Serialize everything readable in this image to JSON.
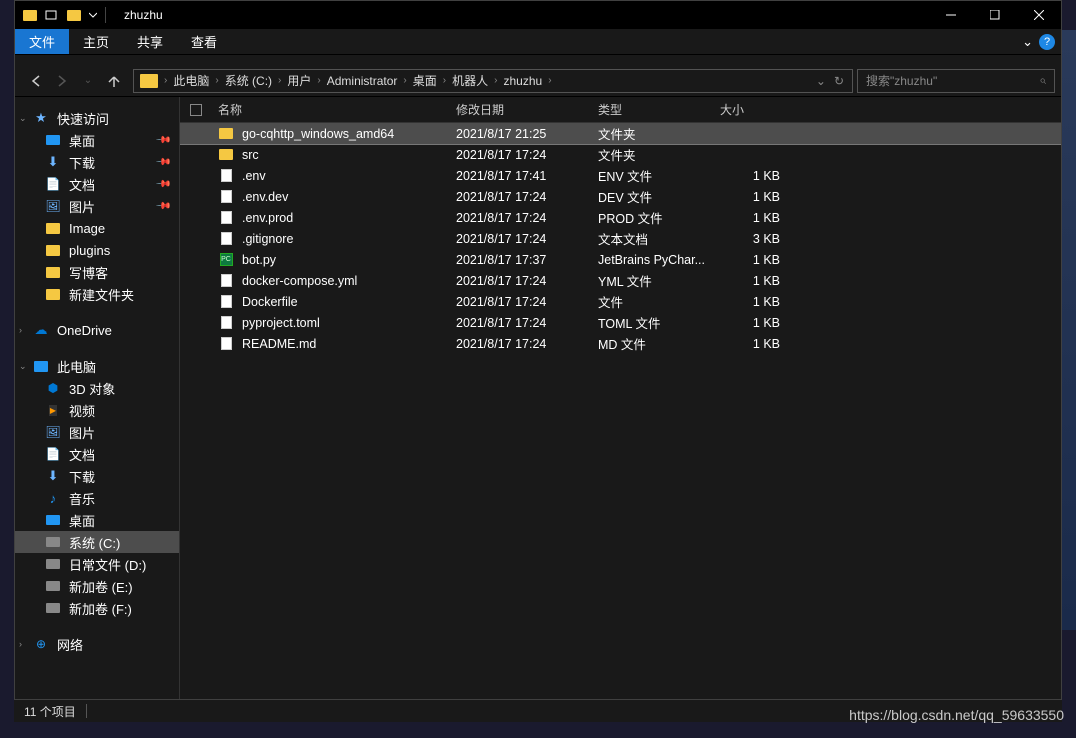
{
  "window": {
    "title": "zhuzhu",
    "controls": {
      "minimize": "–",
      "maximize": "□",
      "close": "×"
    }
  },
  "ribbon": {
    "file": "文件",
    "home": "主页",
    "share": "共享",
    "view": "查看",
    "chevron": "⌄",
    "help": "?"
  },
  "nav": {
    "back": "←",
    "forward": "→",
    "dropdown": "⌄",
    "up": "↑",
    "refresh": "↻",
    "addr_dropdown": "⌄"
  },
  "breadcrumbs": [
    "此电脑",
    "系统 (C:)",
    "用户",
    "Administrator",
    "桌面",
    "机器人",
    "zhuzhu"
  ],
  "search": {
    "placeholder": "搜索\"zhuzhu\"",
    "icon": "⌕"
  },
  "sidebar": {
    "quick_access": {
      "label": "快速访问",
      "items": [
        {
          "label": "桌面",
          "icon": "desktop",
          "pinned": true
        },
        {
          "label": "下载",
          "icon": "download",
          "pinned": true
        },
        {
          "label": "文档",
          "icon": "doc",
          "pinned": true
        },
        {
          "label": "图片",
          "icon": "pic",
          "pinned": true
        },
        {
          "label": "Image",
          "icon": "folder",
          "pinned": false
        },
        {
          "label": "plugins",
          "icon": "folder",
          "pinned": false
        },
        {
          "label": "写博客",
          "icon": "folder",
          "pinned": false
        },
        {
          "label": "新建文件夹",
          "icon": "folder",
          "pinned": false
        }
      ]
    },
    "onedrive": {
      "label": "OneDrive"
    },
    "this_pc": {
      "label": "此电脑",
      "items": [
        {
          "label": "3D 对象",
          "icon": "3d"
        },
        {
          "label": "视频",
          "icon": "video"
        },
        {
          "label": "图片",
          "icon": "pic"
        },
        {
          "label": "文档",
          "icon": "doc"
        },
        {
          "label": "下载",
          "icon": "download"
        },
        {
          "label": "音乐",
          "icon": "music"
        },
        {
          "label": "桌面",
          "icon": "desktop"
        },
        {
          "label": "系统 (C:)",
          "icon": "drive",
          "selected": true
        },
        {
          "label": "日常文件 (D:)",
          "icon": "drive"
        },
        {
          "label": "新加卷 (E:)",
          "icon": "drive"
        },
        {
          "label": "新加卷 (F:)",
          "icon": "drive"
        }
      ]
    },
    "network": {
      "label": "网络"
    }
  },
  "columns": {
    "name": "名称",
    "date": "修改日期",
    "type": "类型",
    "size": "大小"
  },
  "files": [
    {
      "name": "go-cqhttp_windows_amd64",
      "date": "2021/8/17 21:25",
      "type": "文件夹",
      "size": "",
      "icon": "folder",
      "selected": true
    },
    {
      "name": "src",
      "date": "2021/8/17 17:24",
      "type": "文件夹",
      "size": "",
      "icon": "folder"
    },
    {
      "name": ".env",
      "date": "2021/8/17 17:41",
      "type": "ENV 文件",
      "size": "1 KB",
      "icon": "file"
    },
    {
      "name": ".env.dev",
      "date": "2021/8/17 17:24",
      "type": "DEV 文件",
      "size": "1 KB",
      "icon": "file"
    },
    {
      "name": ".env.prod",
      "date": "2021/8/17 17:24",
      "type": "PROD 文件",
      "size": "1 KB",
      "icon": "file"
    },
    {
      "name": ".gitignore",
      "date": "2021/8/17 17:24",
      "type": "文本文档",
      "size": "3 KB",
      "icon": "file"
    },
    {
      "name": "bot.py",
      "date": "2021/8/17 17:37",
      "type": "JetBrains PyChar...",
      "size": "1 KB",
      "icon": "py"
    },
    {
      "name": "docker-compose.yml",
      "date": "2021/8/17 17:24",
      "type": "YML 文件",
      "size": "1 KB",
      "icon": "file"
    },
    {
      "name": "Dockerfile",
      "date": "2021/8/17 17:24",
      "type": "文件",
      "size": "1 KB",
      "icon": "file"
    },
    {
      "name": "pyproject.toml",
      "date": "2021/8/17 17:24",
      "type": "TOML 文件",
      "size": "1 KB",
      "icon": "file"
    },
    {
      "name": "README.md",
      "date": "2021/8/17 17:24",
      "type": "MD 文件",
      "size": "1 KB",
      "icon": "file"
    }
  ],
  "status": {
    "count": "11 个项目"
  },
  "watermark": "https://blog.csdn.net/qq_59633550"
}
